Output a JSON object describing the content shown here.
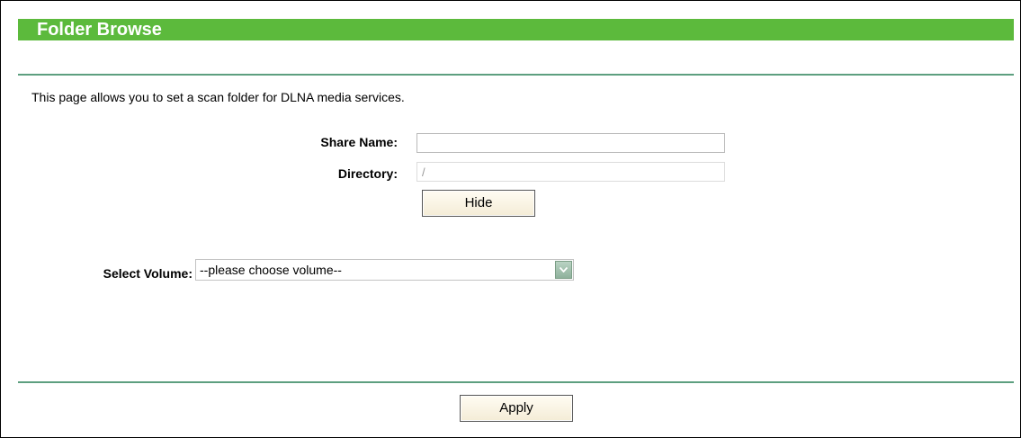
{
  "header": {
    "title": "Folder Browse"
  },
  "description": "This page allows you to set a scan folder for DLNA media services.",
  "form": {
    "share_name_label": "Share Name:",
    "share_name_value": "",
    "directory_label": "Directory:",
    "directory_value": "/",
    "hide_button_label": "Hide",
    "select_volume_label": "Select Volume:",
    "select_volume_value": "--please choose volume--"
  },
  "footer": {
    "apply_button_label": "Apply"
  },
  "colors": {
    "header_bg": "#5cba3c",
    "rule": "#5d9f7f"
  },
  "icons": {
    "select_arrow": "chevron-down-icon"
  }
}
